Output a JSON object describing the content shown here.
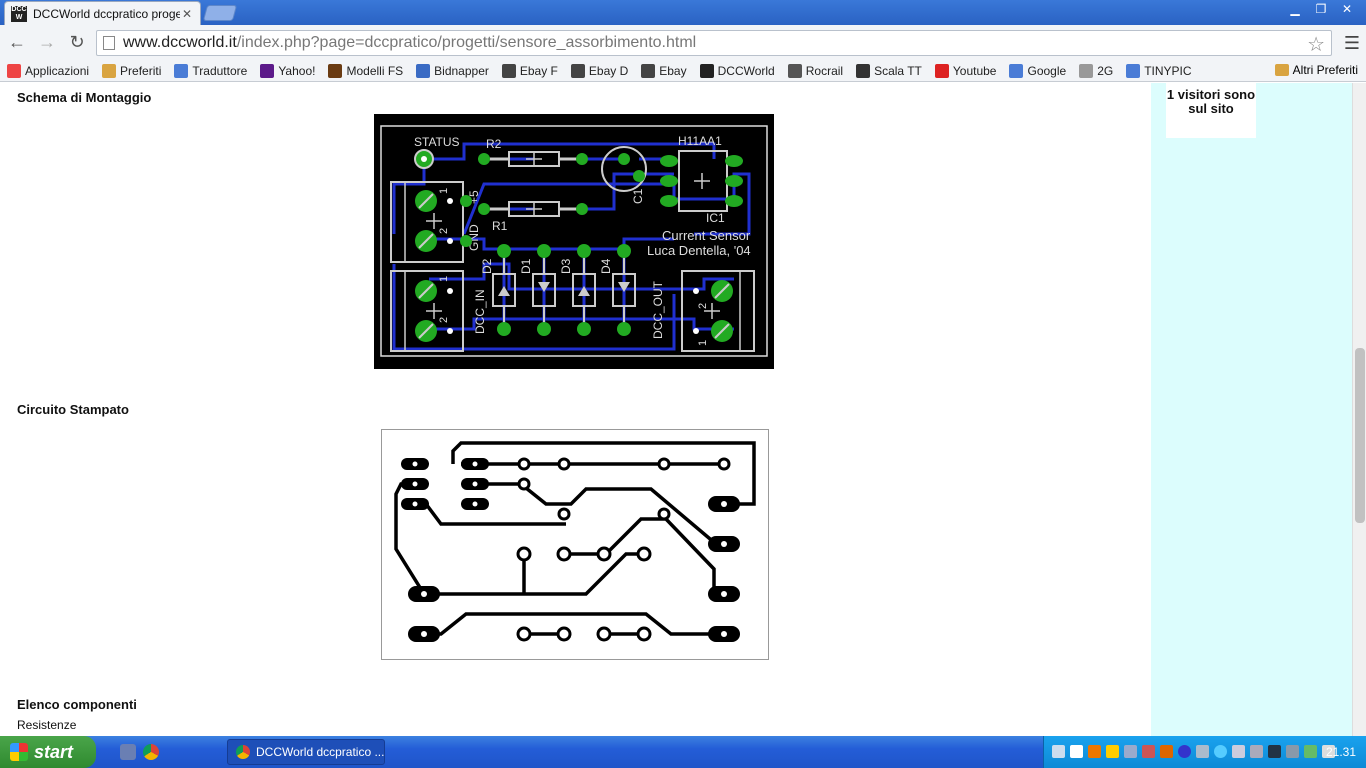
{
  "browser": {
    "tab": {
      "title": "DCCWorld dccpratico progetti",
      "favicon": "dccworld-logo"
    },
    "url_host": "www.dccworld.it",
    "url_path": "/index.php?page=dccpratico/progetti/sensore_assorbimento.html",
    "bookmarks": [
      {
        "label": "Applicazioni",
        "icon": "apps-grid-icon",
        "color": "#e44"
      },
      {
        "label": "Preferiti",
        "icon": "folder-icon",
        "color": "#d9a441"
      },
      {
        "label": "Traduttore",
        "icon": "translate-icon",
        "color": "#4a7cd6"
      },
      {
        "label": "Yahoo!",
        "icon": "yahoo-icon",
        "color": "#5c1a8a"
      },
      {
        "label": "Modelli FS",
        "icon": "modelli-icon",
        "color": "#6a3b12"
      },
      {
        "label": "Bidnapper",
        "icon": "bidnapper-icon",
        "color": "#3a6bc4"
      },
      {
        "label": "Ebay F",
        "icon": "ebay-icon",
        "color": "#444"
      },
      {
        "label": "Ebay D",
        "icon": "ebay-icon",
        "color": "#444"
      },
      {
        "label": "Ebay",
        "icon": "ebay-icon",
        "color": "#444"
      },
      {
        "label": "DCCWorld",
        "icon": "dccworld-icon",
        "color": "#222"
      },
      {
        "label": "Rocrail",
        "icon": "train-icon",
        "color": "#555"
      },
      {
        "label": "Scala TT",
        "icon": "scala-icon",
        "color": "#333"
      },
      {
        "label": "Youtube",
        "icon": "youtube-icon",
        "color": "#d22"
      },
      {
        "label": "Google",
        "icon": "google-icon",
        "color": "#4a7cd6"
      },
      {
        "label": "2G",
        "icon": "page-icon",
        "color": "#999"
      },
      {
        "label": "TINYPIC",
        "icon": "tinypic-icon",
        "color": "#4a7cd6"
      }
    ],
    "other_bookmarks": "Altri Preferiti"
  },
  "page": {
    "heading_schema": "Schema di Montaggio",
    "heading_pcb": "Circuito Stampato",
    "heading_components": "Elenco componenti",
    "sub_resistors": "Resistenze",
    "visitors": "1 visitori sono sul sito",
    "schema_labels": {
      "status": "STATUS",
      "r2": "R2",
      "r1": "R1",
      "h11aa1": "H11AA1",
      "ic1": "IC1",
      "c1": "C1",
      "current_sensor": "Current Sensor",
      "author": "Luca Dentella, '04",
      "gnd": "GND",
      "plus5": "+5",
      "d1": "D1",
      "d2": "D2",
      "d3": "D3",
      "d4": "D4",
      "dcc_in": "DCC_IN",
      "dcc_out": "DCC_OUT",
      "one": "1",
      "two": "2"
    }
  },
  "taskbar": {
    "start": "start",
    "task_title": "DCCWorld dccpratico ...",
    "clock": "21.31"
  }
}
